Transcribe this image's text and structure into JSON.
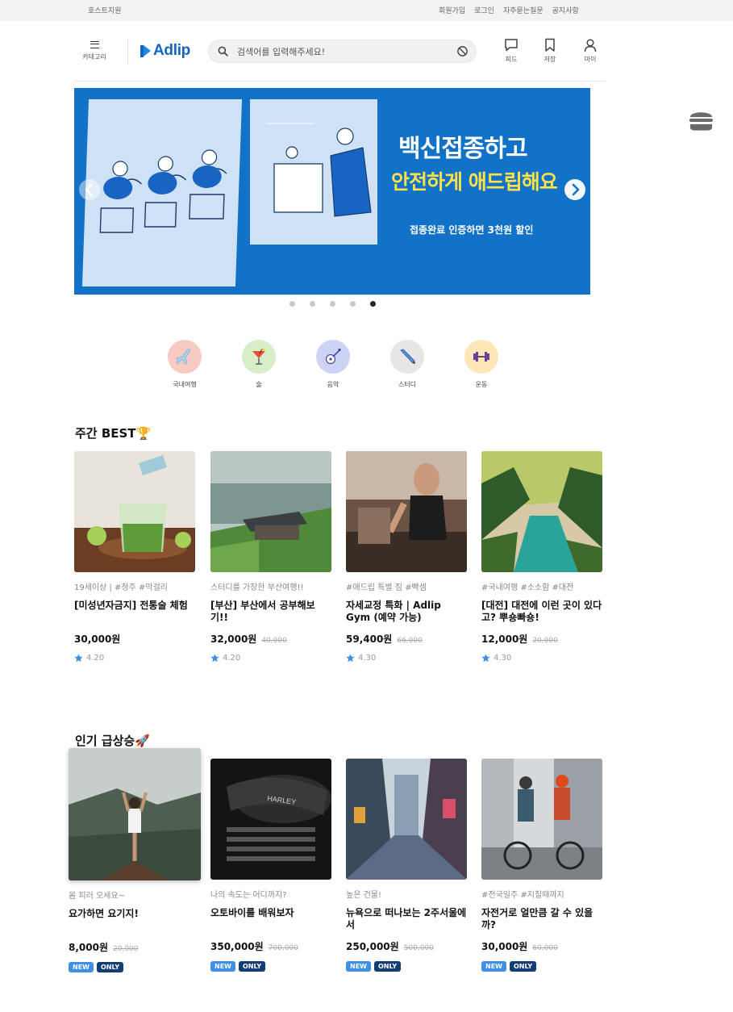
{
  "topbar": {
    "host_support": "호스트지원",
    "links": [
      "회원가입",
      "로그인",
      "자주묻는질문",
      "공지사항"
    ]
  },
  "header": {
    "category_label": "카테고리",
    "logo_text": "Adlip",
    "search": {
      "placeholder": "검색어를 입력해주세요!",
      "value": ""
    },
    "icons": [
      {
        "name": "feed-icon",
        "label": "피드"
      },
      {
        "name": "bookmark-icon",
        "label": "저장"
      },
      {
        "name": "user-icon",
        "label": "마이"
      }
    ]
  },
  "banner": {
    "headline1": "백신접종하고",
    "headline2": "안전하게 애드립해요",
    "subtext": "접종완료 인증하면 3천원 할인",
    "slide_count": 5,
    "active_slide": 5,
    "colors": {
      "background": "#1172c7",
      "highlight": "#ffe14a"
    }
  },
  "categories": [
    {
      "label": "국내여행",
      "icon": "airplane-icon",
      "bg": "#f7cbc1"
    },
    {
      "label": "술",
      "icon": "cocktail-icon",
      "bg": "#d8eec9"
    },
    {
      "label": "음악",
      "icon": "guitar-icon",
      "bg": "#cdd3f5"
    },
    {
      "label": "스터디",
      "icon": "pencil-icon",
      "bg": "#e6e6e6"
    },
    {
      "label": "운동",
      "icon": "dumbbell-icon",
      "bg": "#fde7b9"
    }
  ],
  "weekly_best": {
    "title": "주간 BEST🏆",
    "items": [
      {
        "tags": "19세이상 | #청주 #막걸리",
        "name": "[미성년자금지] 전통술 체험",
        "price": "30,000원",
        "original_price": "",
        "rating": "4.20",
        "image": "cocktail-photo"
      },
      {
        "tags": "스터디를 가장한 부산여행!!",
        "name": "[부산] 부산에서 공부해보기!!",
        "price": "32,000원",
        "original_price": "40,000",
        "rating": "4.20",
        "image": "busan-temple-photo"
      },
      {
        "tags": "#애드립 특별 짐 #빡셈",
        "name": "자세교정 특화 | Adlip Gym (예약 가능)",
        "price": "59,400원",
        "original_price": "66,000",
        "rating": "4.30",
        "image": "gym-runner-photo"
      },
      {
        "tags": "#국내여행 #소소함 #대전",
        "name": "[대전] 대전에 이런 곳이 있다고? 뿌숑빠숑!",
        "price": "12,000원",
        "original_price": "20,000",
        "rating": "4.30",
        "image": "jungle-river-photo"
      }
    ]
  },
  "rising": {
    "title": "인기 급상승🚀",
    "items": [
      {
        "tags": "몸 피러 오세요~",
        "name": "요가하면 요기지!",
        "price": "8,000원",
        "original_price": "20,000",
        "badges": [
          "NEW",
          "ONLY"
        ],
        "image": "yoga-mountain-photo"
      },
      {
        "tags": "나의 속도는 어디까지?",
        "name": "오토바이를 배워보자",
        "price": "350,000원",
        "original_price": "700,000",
        "badges": [
          "NEW",
          "ONLY"
        ],
        "image": "motorcycle-photo"
      },
      {
        "tags": "높은 건물!",
        "name": "뉴욕으로 떠나보는 2주서울에서",
        "price": "250,000원",
        "original_price": "500,000",
        "badges": [
          "NEW",
          "ONLY"
        ],
        "image": "city-street-photo"
      },
      {
        "tags": "#전국일주 #지칠때까지",
        "name": "자전거로 얼만큼 갈 수 있을까?",
        "price": "30,000원",
        "original_price": "60,000",
        "badges": [
          "NEW",
          "ONLY"
        ],
        "image": "cyclists-photo"
      }
    ]
  }
}
